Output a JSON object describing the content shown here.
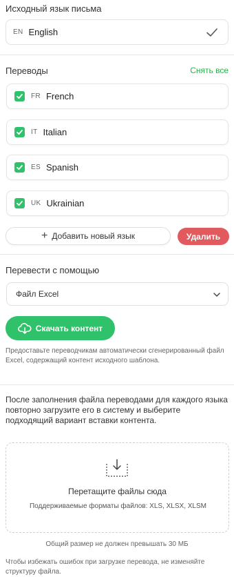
{
  "source": {
    "label": "Исходный язык письма",
    "code": "EN",
    "language": "English"
  },
  "translations": {
    "label": "Переводы",
    "clear_all": "Снять все",
    "items": [
      {
        "code": "FR",
        "language": "French",
        "checked": true
      },
      {
        "code": "IT",
        "language": "Italian",
        "checked": true
      },
      {
        "code": "ES",
        "language": "Spanish",
        "checked": true
      },
      {
        "code": "UK",
        "language": "Ukrainian",
        "checked": true
      }
    ],
    "add_button": "Добавить новый язык",
    "delete_button": "Удалить"
  },
  "translate_with": {
    "label": "Перевести с помощью",
    "selected": "Файл Excel",
    "download_button": "Скачать контент",
    "hint": "Предоставьте переводчикам автоматически сгенерированный файл Excel, содержащий контент исходного шаблона."
  },
  "upload": {
    "info": "После заполнения файла переводами для каждого языка повторно загрузите его в систему и выберите подходящий вариант вставки контента.",
    "drop_title": "Перетащите файлы сюда",
    "formats": "Поддерживаемые форматы файлов: XLS, XLSX, XLSM",
    "size_note": "Общий размер не должен превышать 30 МБ",
    "structure_note": "Чтобы избежать ошибок при загрузке перевода, не изменяйте структуру файла."
  },
  "colors": {
    "accent_green": "#2fc26a",
    "link_green": "#2bb04b",
    "danger_red": "#e15a5e"
  }
}
